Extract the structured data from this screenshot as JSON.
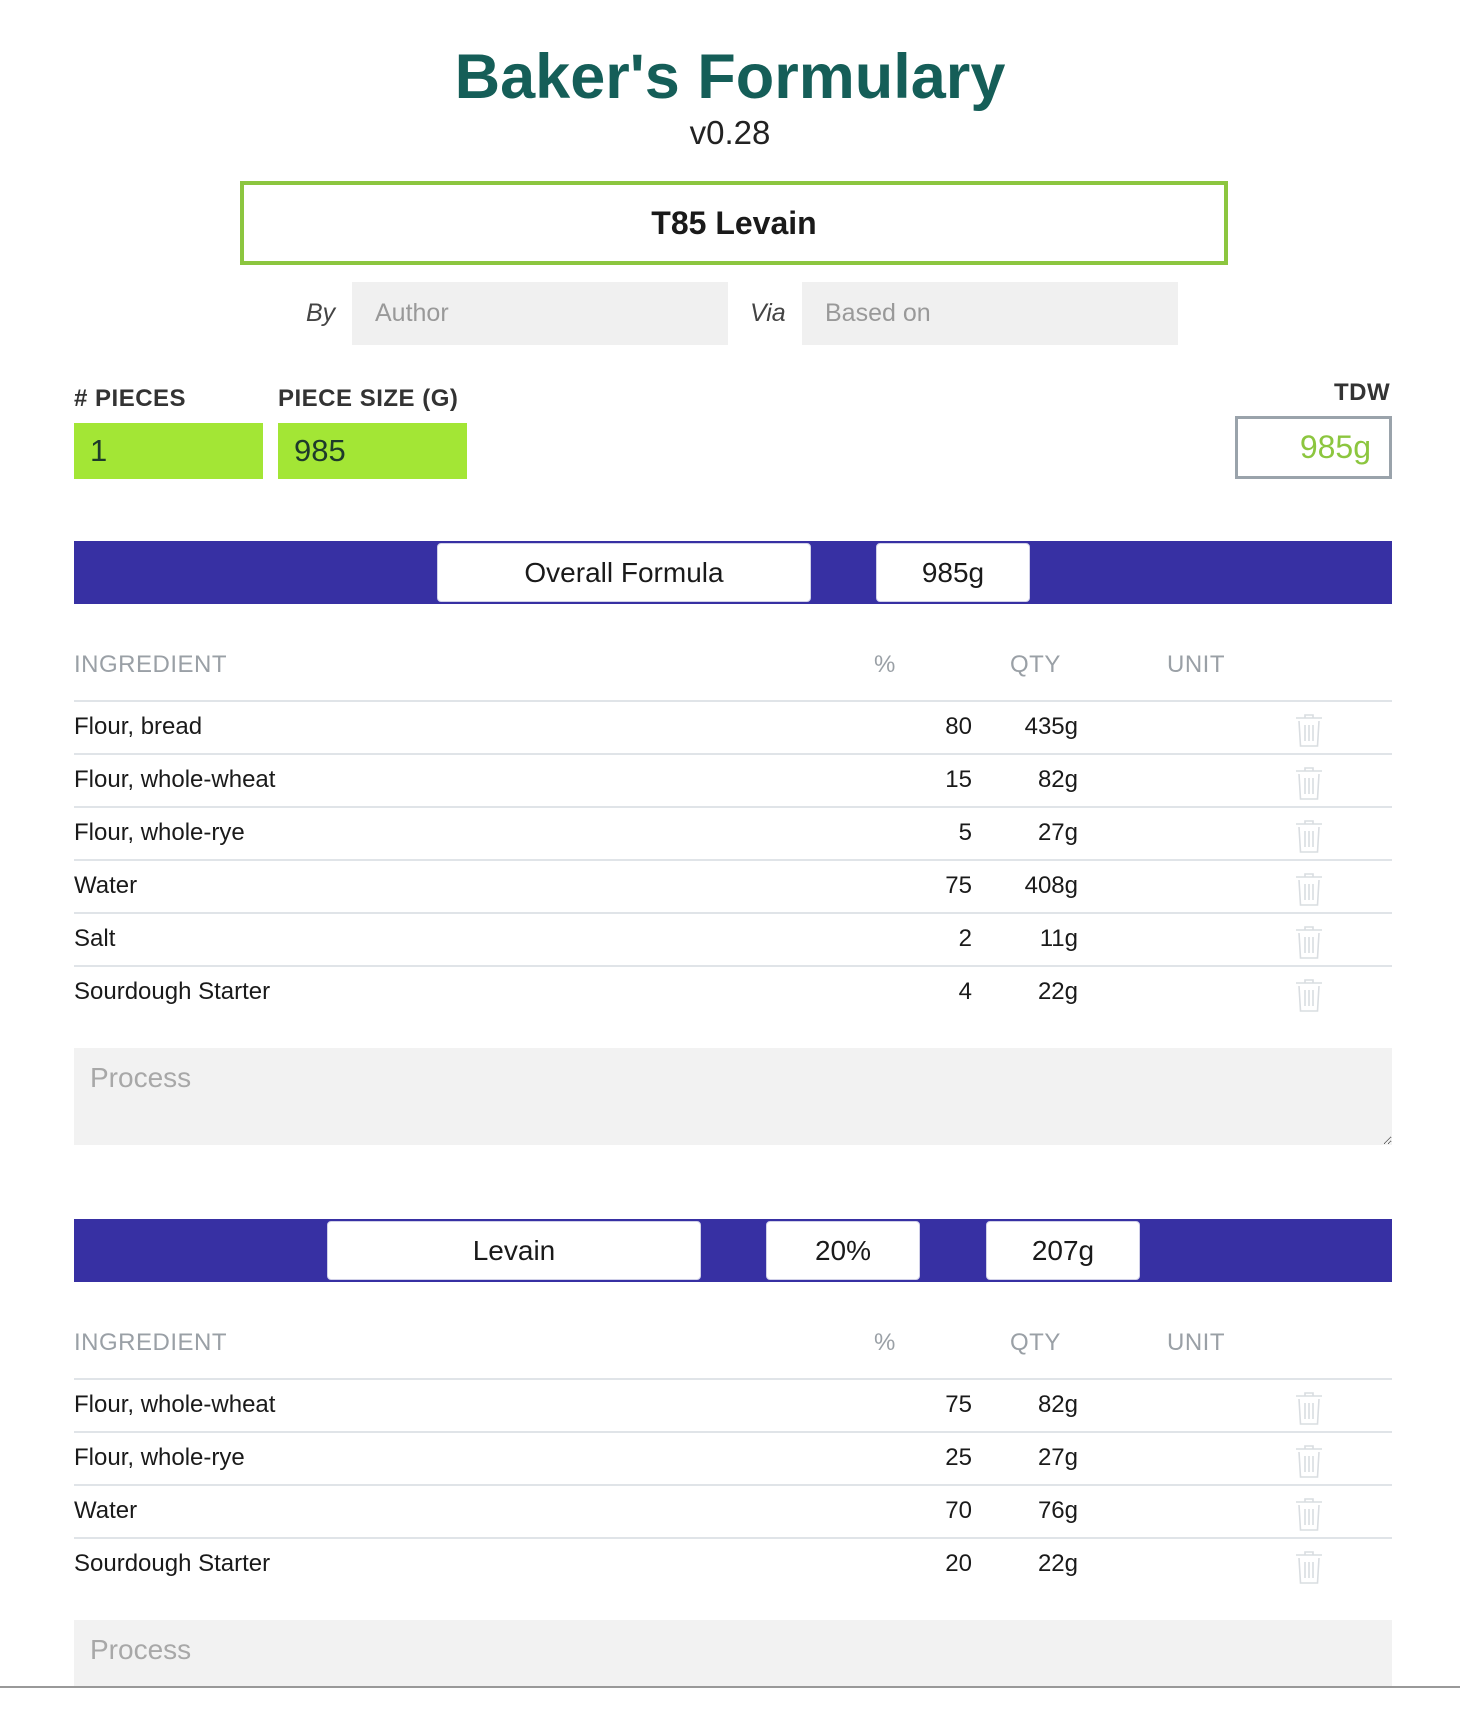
{
  "app": {
    "title": "Baker's Formulary",
    "version": "v0.28"
  },
  "recipe": {
    "name": "T85 Levain"
  },
  "meta": {
    "by_label": "By",
    "author_placeholder": "Author",
    "via_label": "Via",
    "based_on_placeholder": "Based on"
  },
  "dough": {
    "pieces_label": "# PIECES",
    "pieces_value": "1",
    "piece_size_label": "PIECE SIZE (G)",
    "piece_size_value": "985",
    "tdw_label": "TDW",
    "tdw_value": "985g"
  },
  "table_headers": {
    "ingredient": "INGREDIENT",
    "pct": "%",
    "qty": "QTY",
    "unit": "UNIT"
  },
  "sections": [
    {
      "name": "Overall Formula",
      "total": "985g",
      "rows": [
        {
          "ingredient": "Flour, bread",
          "pct": "80",
          "qty": "435g"
        },
        {
          "ingredient": "Flour, whole-wheat",
          "pct": "15",
          "qty": "82g"
        },
        {
          "ingredient": "Flour, whole-rye",
          "pct": "5",
          "qty": "27g"
        },
        {
          "ingredient": "Water",
          "pct": "75",
          "qty": "408g"
        },
        {
          "ingredient": "Salt",
          "pct": "2",
          "qty": "11g"
        },
        {
          "ingredient": "Sourdough Starter",
          "pct": "4",
          "qty": "22g"
        }
      ],
      "process_placeholder": "Process"
    },
    {
      "name": "Levain",
      "percent": "20%",
      "total": "207g",
      "rows": [
        {
          "ingredient": "Flour, whole-wheat",
          "pct": "75",
          "qty": "82g"
        },
        {
          "ingredient": "Flour, whole-rye",
          "pct": "25",
          "qty": "27g"
        },
        {
          "ingredient": "Water",
          "pct": "70",
          "qty": "76g"
        },
        {
          "ingredient": "Sourdough Starter",
          "pct": "20",
          "qty": "22g"
        }
      ],
      "process_placeholder": "Process"
    }
  ],
  "colors": {
    "brand": "#155e58",
    "band": "#3730a3",
    "accent": "#a3e635",
    "tdw_text": "#8cc63f"
  },
  "icons": {
    "row_delete": "trash-icon"
  }
}
